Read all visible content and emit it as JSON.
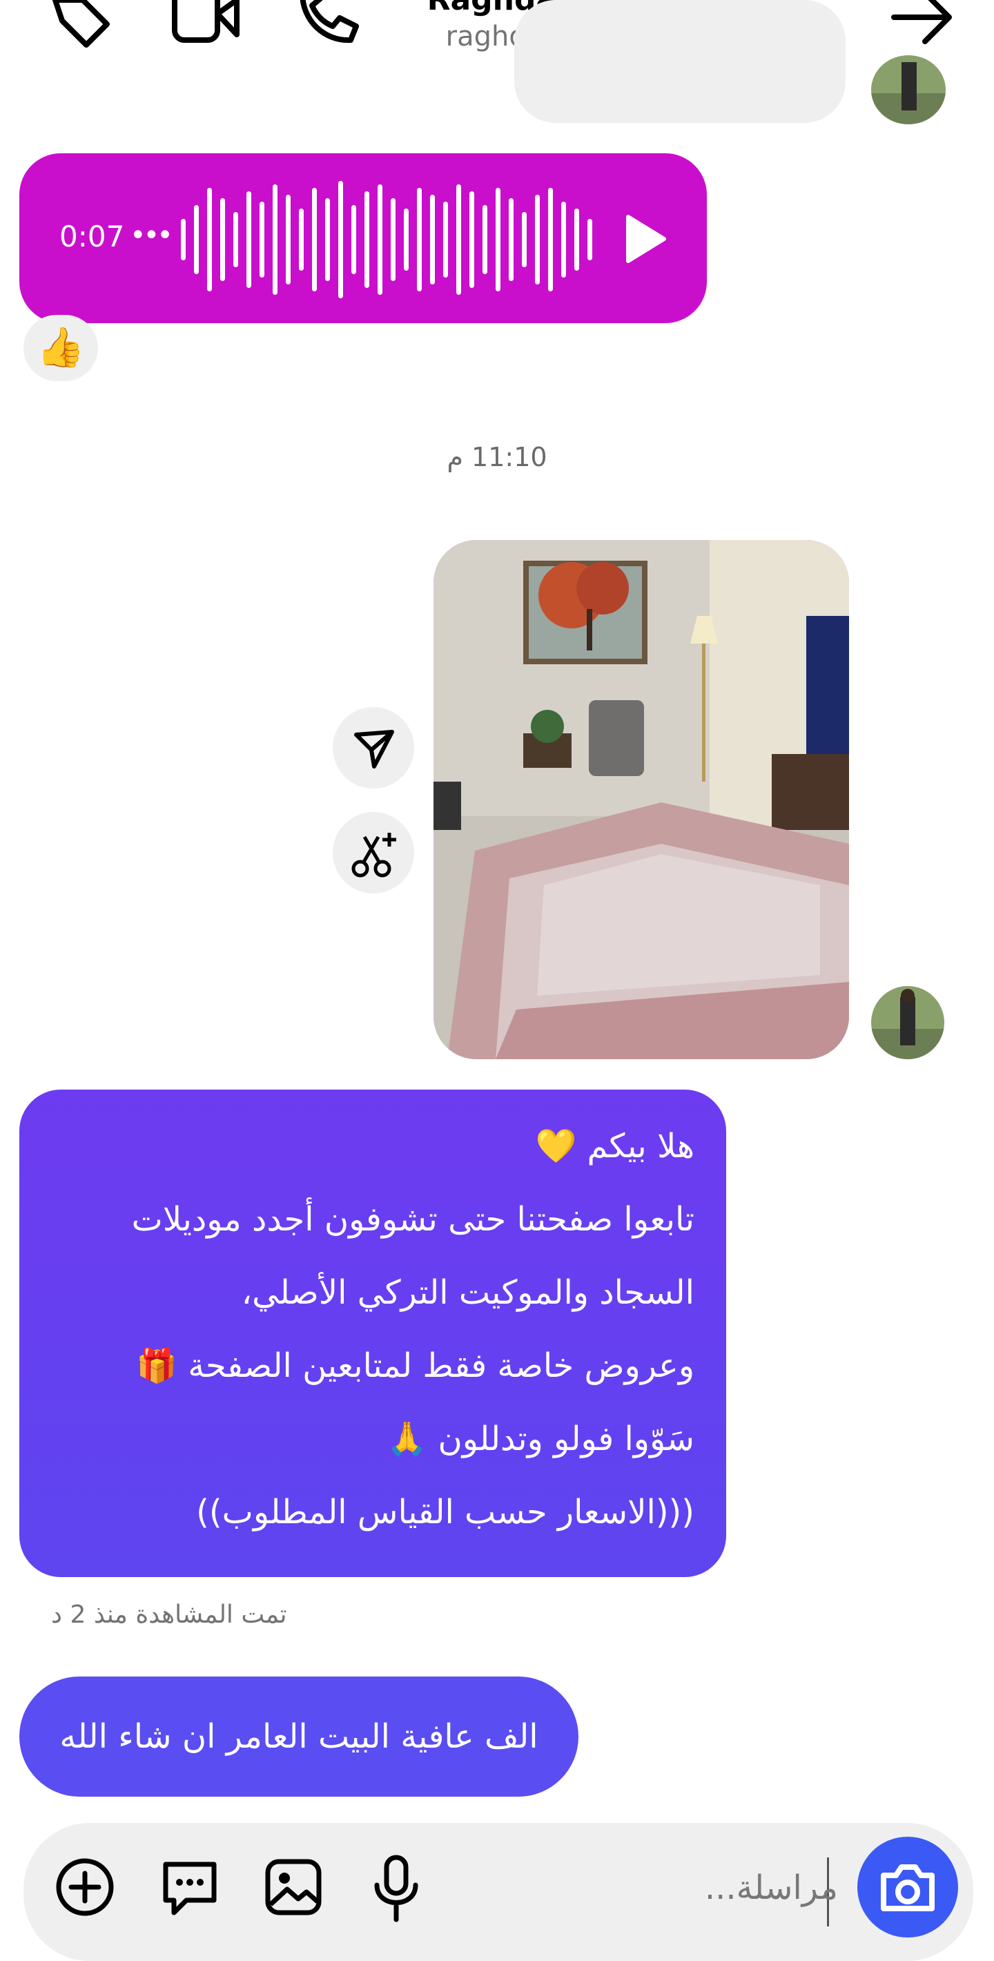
{
  "header": {
    "title": "Raghda Abdu...",
    "username": "raghda_abdullah_",
    "icons": [
      "tag-icon",
      "video-call-icon",
      "phone-icon",
      "back-arrow-icon"
    ]
  },
  "voice_message": {
    "duration": "0:07",
    "dots": "•••",
    "reaction": "👍",
    "color": "#c90fcc"
  },
  "timestamp": "11:10 م",
  "image_message": {
    "actions": [
      "share-icon",
      "remix-icon"
    ]
  },
  "text_message": {
    "lines": [
      "هلا بيكم 💛",
      "تابعوا صفحتنا حتى تشوفون أجدد موديلات",
      "السجاد والموكيت التركي الأصلي،",
      "وعروض خاصة فقط لمتابعين الصفحة 🎁",
      "سَوّوا فولو وتدللون 🙏",
      "(((الاسعار حسب القياس المطلوب))"
    ],
    "color": "#6040f0"
  },
  "seen_status": "تمت المشاهدة منذ 2 د",
  "reply_message": "الف عافية البيت العامر ان شاء الله",
  "composer": {
    "placeholder": "مراسلة..."
  },
  "colors": {
    "accent": "#3b59f5",
    "bubble_gray": "#efefef"
  }
}
